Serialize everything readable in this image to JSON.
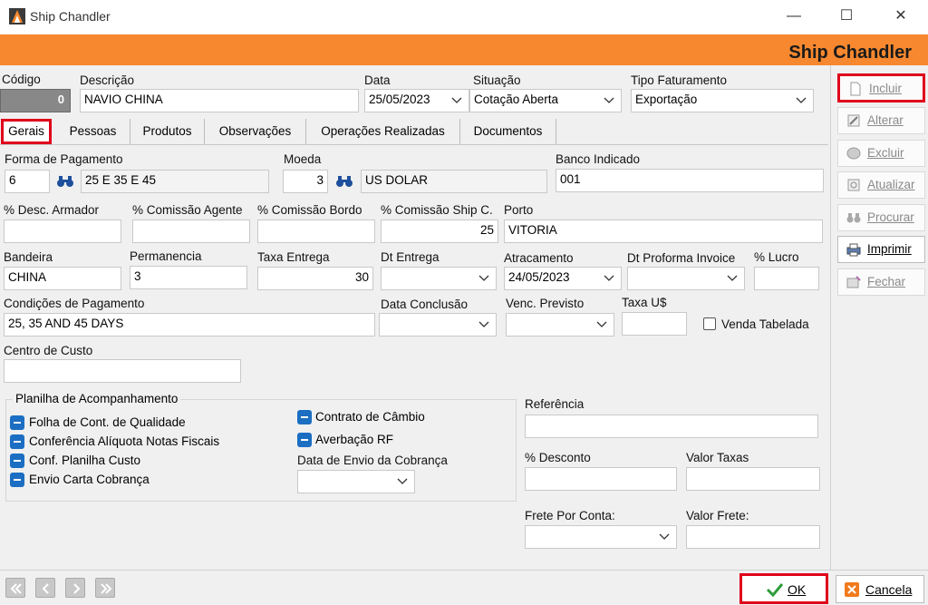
{
  "window": {
    "title": "Ship Chandler",
    "header_title": "Ship Chandler",
    "minimize": "—",
    "maximize": "☐",
    "close": "✕"
  },
  "header_fields": {
    "codigo": {
      "label": "Código",
      "value": "0"
    },
    "descricao": {
      "label": "Descrição",
      "value": "NAVIO CHINA"
    },
    "data": {
      "label": "Data",
      "value": "25/05/2023"
    },
    "situacao": {
      "label": "Situação",
      "value": "Cotação Aberta"
    },
    "tipo_faturamento": {
      "label": "Tipo Faturamento",
      "value": "Exportação"
    }
  },
  "tabs": [
    {
      "label": "Gerais",
      "active": true
    },
    {
      "label": "Pessoas"
    },
    {
      "label": "Produtos"
    },
    {
      "label": "Observações"
    },
    {
      "label": "Operações Realizadas"
    },
    {
      "label": "Documentos"
    }
  ],
  "form": {
    "forma_pagamento": {
      "label": "Forma de Pagamento",
      "code": "6",
      "desc": "25 E 35 E 45"
    },
    "moeda": {
      "label": "Moeda",
      "code": "3",
      "desc": "US DOLAR"
    },
    "banco_indicado": {
      "label": "Banco Indicado",
      "value": "001"
    },
    "desc_armador": {
      "label": "% Desc. Armador",
      "value": ""
    },
    "comissao_agente": {
      "label": "% Comissão Agente",
      "value": ""
    },
    "comissao_bordo": {
      "label": "% Comissão Bordo",
      "value": ""
    },
    "comissao_ship": {
      "label": "% Comissão Ship C.",
      "value": "25"
    },
    "porto": {
      "label": "Porto",
      "value": "VITORIA"
    },
    "bandeira": {
      "label": "Bandeira",
      "value": "CHINA"
    },
    "permanencia": {
      "label": "Permanencia",
      "value": "3"
    },
    "taxa_entrega": {
      "label": "Taxa Entrega",
      "value": "30"
    },
    "dt_entrega": {
      "label": "Dt Entrega",
      "value": ""
    },
    "atracamento": {
      "label": "Atracamento",
      "value": "24/05/2023"
    },
    "dt_proforma": {
      "label": "Dt Proforma Invoice",
      "value": ""
    },
    "lucro": {
      "label": "% Lucro",
      "value": ""
    },
    "condicoes_pagamento": {
      "label": "Condições de Pagamento",
      "value": "25, 35 AND 45 DAYS"
    },
    "data_conclusao": {
      "label": "Data Conclusão",
      "value": ""
    },
    "venc_previsto": {
      "label": "Venc. Previsto",
      "value": ""
    },
    "taxa_us": {
      "label": "Taxa U$",
      "value": ""
    },
    "venda_tabelada": {
      "label": "Venda Tabelada",
      "checked": false
    },
    "centro_custo": {
      "label": "Centro de Custo",
      "value": ""
    }
  },
  "planilha": {
    "title": "Planilha de Acompanhamento",
    "items_left": [
      "Folha de Cont. de Qualidade",
      "Conferência Alíquota Notas Fiscais",
      "Conf. Planilha Custo",
      "Envio Carta Cobrança"
    ],
    "items_right": [
      "Contrato de Câmbio",
      "Averbação RF"
    ],
    "data_envio": {
      "label": "Data de Envio da Cobrança",
      "value": ""
    }
  },
  "right_fields": {
    "referencia": {
      "label": "Referência",
      "value": ""
    },
    "desconto": {
      "label": "% Desconto",
      "value": ""
    },
    "valor_taxas": {
      "label": "Valor Taxas",
      "value": ""
    },
    "frete_por_conta": {
      "label": "Frete Por Conta:",
      "value": ""
    },
    "valor_frete": {
      "label": "Valor Frete:",
      "value": ""
    }
  },
  "sidebar": {
    "incluir": "Incluir",
    "alterar": "Alterar",
    "excluir": "Excluir",
    "atualizar": "Atualizar",
    "procurar": "Procurar",
    "imprimir": "Imprimir",
    "fechar": "Fechar"
  },
  "bottom": {
    "ok": "OK",
    "cancela": "Cancela"
  },
  "colors": {
    "accent": "#f7882f",
    "highlight": "#e0001b",
    "checkbox": "#1b6ec2"
  }
}
